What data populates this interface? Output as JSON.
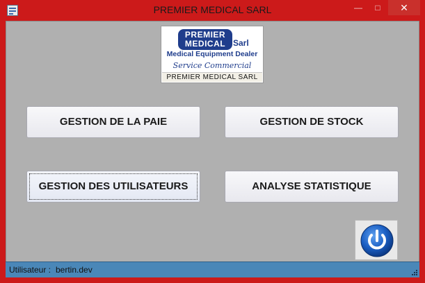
{
  "window": {
    "title": "PREMIER MEDICAL SARL",
    "minimize_glyph": "—",
    "maximize_glyph": "□",
    "close_glyph": "✕"
  },
  "logo": {
    "line1": "PREMIER",
    "line2": "MEDICAL",
    "sarl": "Sarl",
    "dealer": "Medical Equipment Dealer",
    "service": "Service Commercial",
    "caption": "PREMIER MEDICAL SARL"
  },
  "menu": {
    "paie": "GESTION DE LA PAIE",
    "stock": "GESTION DE STOCK",
    "users": "GESTION DES UTILISATEURS",
    "stats": "ANALYSE STATISTIQUE"
  },
  "power": {
    "icon": "power-icon"
  },
  "status": {
    "label": "Utilisateur :",
    "user": "bertin.dev"
  },
  "colors": {
    "frame": "#cc1a1a",
    "client": "#b0b0b0",
    "status_bar": "#4a87b8",
    "brand_blue": "#1f3d8c"
  }
}
